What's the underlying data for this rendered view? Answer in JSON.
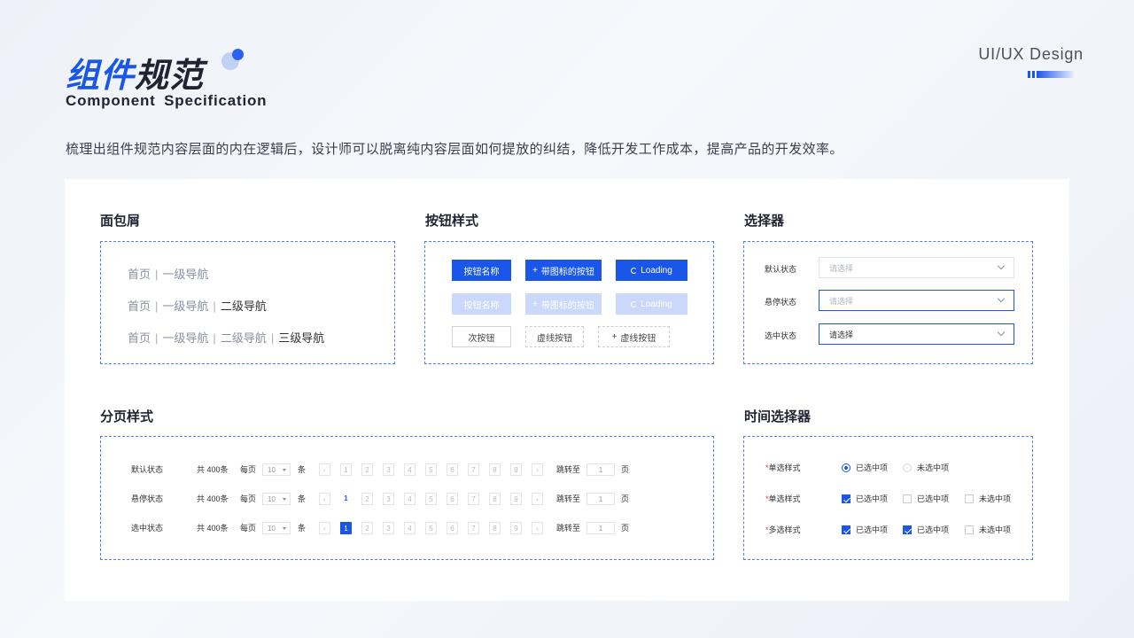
{
  "header": {
    "title_cn_part1": "组件",
    "title_cn_part2": "规范",
    "title_en": "Component Specification",
    "brand": "UI/UX Design",
    "description": "梳理出组件规范内容层面的内在逻辑后，设计师可以脱离纯内容层面如何提放的纠结，降低开发工作成本，提高产品的开发效率。"
  },
  "colors": {
    "accent": "#1a56e8",
    "disabled": "#c9d8fb",
    "required": "#ee3333"
  },
  "breadcrumb": {
    "title": "面包屑",
    "sep": "|",
    "home": "首页",
    "level1": "一级导航",
    "level2": "二级导航",
    "level3": "三级导航"
  },
  "buttons": {
    "title": "按钮样式",
    "name": "按钮名称",
    "icon_button": "带图标的按钮",
    "plus": "+",
    "loading": "Loading",
    "secondary": "次按钮",
    "dashed": "虚线按钮",
    "dashed_plus": "虚线按钮"
  },
  "selector": {
    "title": "选择器",
    "default_label": "默认状态",
    "hover_label": "悬停状态",
    "active_label": "选中状态",
    "placeholder": "请选择",
    "selected_value": "请选择"
  },
  "pagination": {
    "title": "分页样式",
    "rows": [
      {
        "label": "默认状态",
        "state": "default"
      },
      {
        "label": "悬停状态",
        "state": "hover"
      },
      {
        "label": "选中状态",
        "state": "selected"
      }
    ],
    "total": "共 400条",
    "per_page": "每页",
    "page_size": "10",
    "unit": "条",
    "prev": "‹",
    "next": "›",
    "pages": [
      "1",
      "2",
      "3",
      "4",
      "5",
      "6",
      "7",
      "8",
      "9"
    ],
    "jump": "跳转至",
    "jump_value": "1",
    "page_unit": "页"
  },
  "time_selector": {
    "title": "时间选择器",
    "required": "*",
    "row1_label": "单选样式",
    "row2_label": "单选样式",
    "row3_label": "多选样式",
    "checked": "已选中项",
    "unchecked": "未选中项",
    "not_checked": "未选中项"
  }
}
